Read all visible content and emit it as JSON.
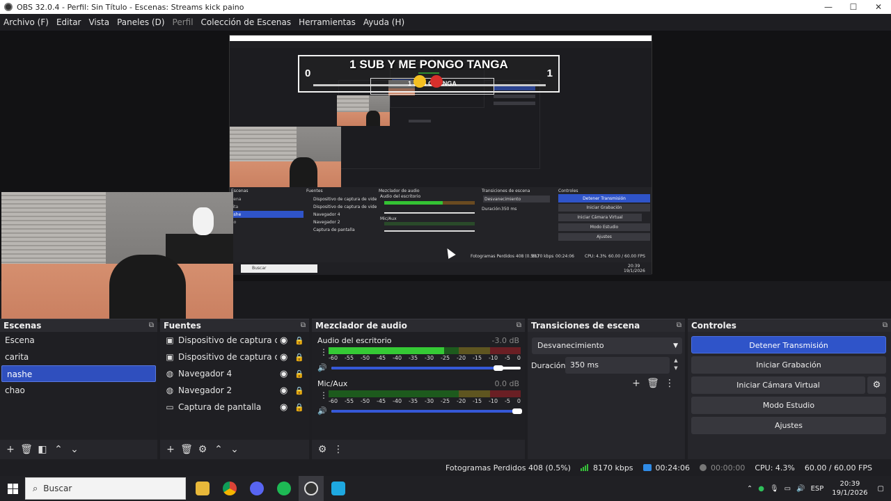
{
  "window": {
    "title": "OBS 32.0.4 - Perfil: Sin Título - Escenas: Streams kick paino",
    "minimize": "—",
    "maximize": "☐",
    "close": "✕"
  },
  "menu": {
    "items": [
      "Archivo (F)",
      "Editar",
      "Vista",
      "Paneles (D)",
      "Perfil",
      "Colección de Escenas",
      "Herramientas",
      "Ayuda (H)"
    ]
  },
  "preview": {
    "overlay_title": "1 SUB Y ME PONGO TANGA",
    "overlay_left": "0",
    "overlay_right": "1",
    "small_overlay_text": "1 SUB        O TANGA",
    "nested_docks": {
      "scenes": "Escenas",
      "sources": "Fuentes",
      "mixer": "Mezclador de audio",
      "transitions": "Transiciones de escena",
      "controls": "Controles",
      "stop_stream": "Detener Transmisión",
      "start_rec": "Iniciar Grabación",
      "virtual_cam": "Iniciar Cámara Virtual",
      "studio": "Modo Estudio",
      "settings": "Ajustes",
      "src1": "Dispositivo de captura de vide",
      "src2": "Dispositivo de captura de vide",
      "src3": "Navegador 4",
      "src4": "Navegador 2",
      "src5": "Captura de pantalla",
      "desktop_audio": "Audio del escritorio",
      "mic": "Mic/Aux",
      "fade": "Desvanecimiento",
      "dur": "Duración",
      "dur_val": "350 ms",
      "scene_partial_1": "cena",
      "scene_partial_2": "rita",
      "scene_partial_3": "ashe",
      "scene_partial_4": "ao",
      "search": "Buscar",
      "status": "Fotogramas Perdidos 408 (0.5%)",
      "kbps": "8170 kbps",
      "time": "00:24:06",
      "cpu": "CPU: 4.3%",
      "fps": "60.00 / 60.00 FPS",
      "clock_time": "20:39",
      "clock_date": "19/1/2026"
    }
  },
  "docks": {
    "scenes": {
      "title": "Escenas",
      "items": [
        "Escena",
        "carita",
        "nashe",
        "chao"
      ],
      "selected_index": 2
    },
    "sources": {
      "title": "Fuentes",
      "items": [
        {
          "name": "Dispositivo de captura de vide",
          "icon": "camera-icon"
        },
        {
          "name": "Dispositivo de captura de vide",
          "icon": "camera-icon"
        },
        {
          "name": "Navegador 4",
          "icon": "globe-icon"
        },
        {
          "name": "Navegador 2",
          "icon": "globe-icon"
        },
        {
          "name": "Captura de pantalla",
          "icon": "monitor-icon"
        }
      ]
    },
    "mixer": {
      "title": "Mezclador de audio",
      "channels": [
        {
          "name": "Audio del escritorio",
          "db": "-3.0 dB",
          "level": 0.6,
          "volume": 0.9
        },
        {
          "name": "Mic/Aux",
          "db": "0.0 dB",
          "level": 0.0,
          "volume": 1.0
        }
      ],
      "ticks": [
        "-60",
        "-55",
        "-50",
        "-45",
        "-40",
        "-35",
        "-30",
        "-25",
        "-20",
        "-15",
        "-10",
        "-5",
        "0"
      ]
    },
    "transitions": {
      "title": "Transiciones de escena",
      "selected": "Desvanecimiento",
      "duration_label": "Duración",
      "duration_value": "350 ms"
    },
    "controls": {
      "title": "Controles",
      "stop_stream": "Detener Transmisión",
      "start_recording": "Iniciar Grabación",
      "start_virtual_cam": "Iniciar Cámara Virtual",
      "studio_mode": "Modo Estudio",
      "settings": "Ajustes"
    }
  },
  "status": {
    "dropped_frames": "Fotogramas Perdidos 408 (0.5%)",
    "bitrate": "8170 kbps",
    "stream_time": "00:24:06",
    "rec_time": "00:00:00",
    "cpu": "CPU: 4.3%",
    "fps": "60.00 / 60.00 FPS"
  },
  "taskbar": {
    "search_placeholder": "Buscar",
    "language": "ESP",
    "time": "20:39",
    "date": "19/1/2026"
  },
  "colors": {
    "accent": "#2f54c9",
    "meter_green": "#35c935",
    "background": "#1e1e22"
  }
}
